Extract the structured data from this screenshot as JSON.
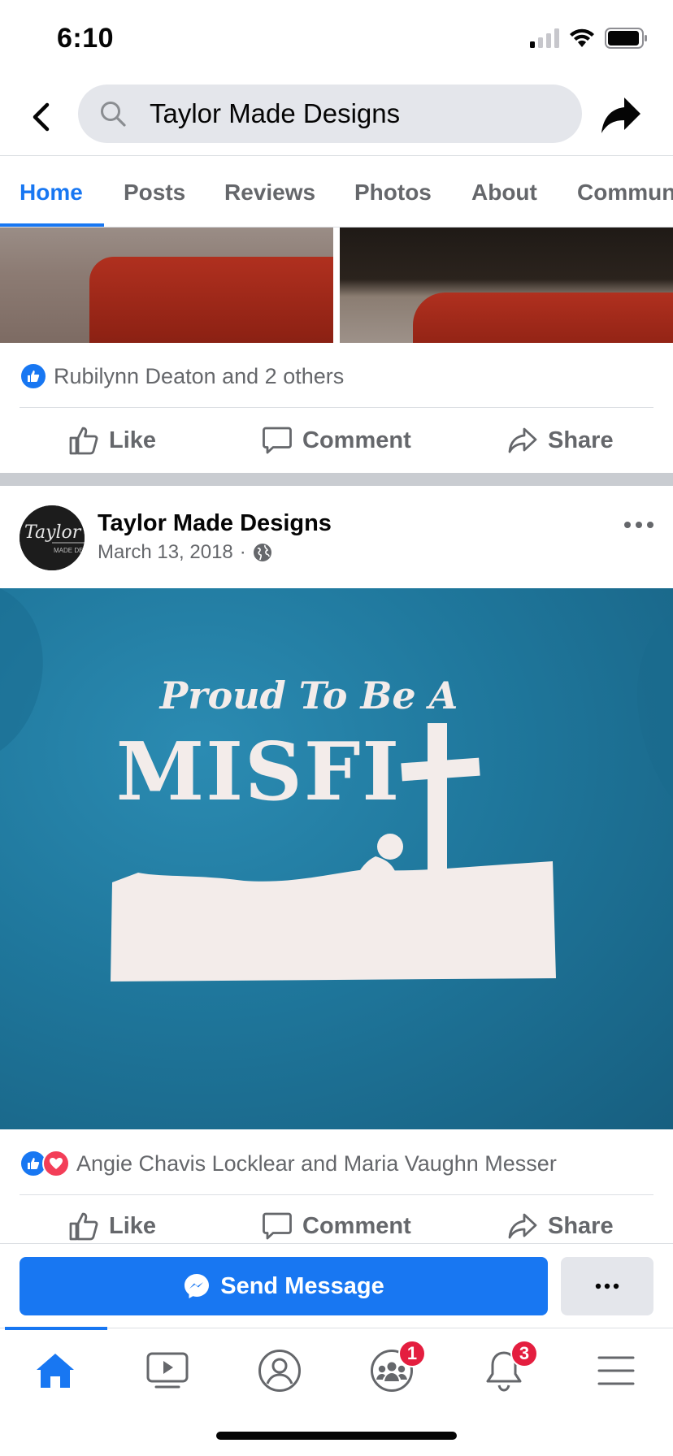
{
  "status_bar": {
    "time": "6:10",
    "signal_icon": "cellular-signal-icon",
    "wifi_icon": "wifi-icon",
    "battery_icon": "battery-icon"
  },
  "header": {
    "back_icon": "chevron-left-icon",
    "search_icon": "search-icon",
    "search_value": "Taylor Made Designs",
    "share_icon": "share-arrow-icon"
  },
  "tabs": [
    {
      "label": "Home",
      "active": true
    },
    {
      "label": "Posts",
      "active": false
    },
    {
      "label": "Reviews",
      "active": false
    },
    {
      "label": "Photos",
      "active": false
    },
    {
      "label": "About",
      "active": false
    },
    {
      "label": "Commun",
      "active": false
    }
  ],
  "post1": {
    "reactions_text": "Rubilynn Deaton and 2 others",
    "actions": {
      "like": "Like",
      "comment": "Comment",
      "share": "Share"
    }
  },
  "post2": {
    "page_name": "Taylor Made Designs",
    "date": "March 13, 2018",
    "separator": "·",
    "privacy_icon": "globe-icon",
    "avatar_text": {
      "script": "Taylor",
      "small": "MADE DESI"
    },
    "image_text": {
      "line1": "Proud To Be A",
      "line2": "MISFI"
    },
    "reactions_text": "Angie Chavis Locklear and Maria Vaughn Messer",
    "actions": {
      "like": "Like",
      "comment": "Comment",
      "share": "Share"
    }
  },
  "message_bar": {
    "send_label": "Send Message",
    "more_label": "···"
  },
  "bottom_nav": {
    "items": [
      {
        "icon": "home-icon",
        "active": true
      },
      {
        "icon": "watch-video-icon",
        "active": false
      },
      {
        "icon": "profile-icon",
        "active": false
      },
      {
        "icon": "groups-icon",
        "badge": "1"
      },
      {
        "icon": "bell-icon",
        "badge": "3"
      },
      {
        "icon": "menu-icon",
        "active": false
      }
    ]
  },
  "colors": {
    "accent": "#1877f2",
    "badge": "#e41e3f",
    "shirt": "#1f779c"
  }
}
